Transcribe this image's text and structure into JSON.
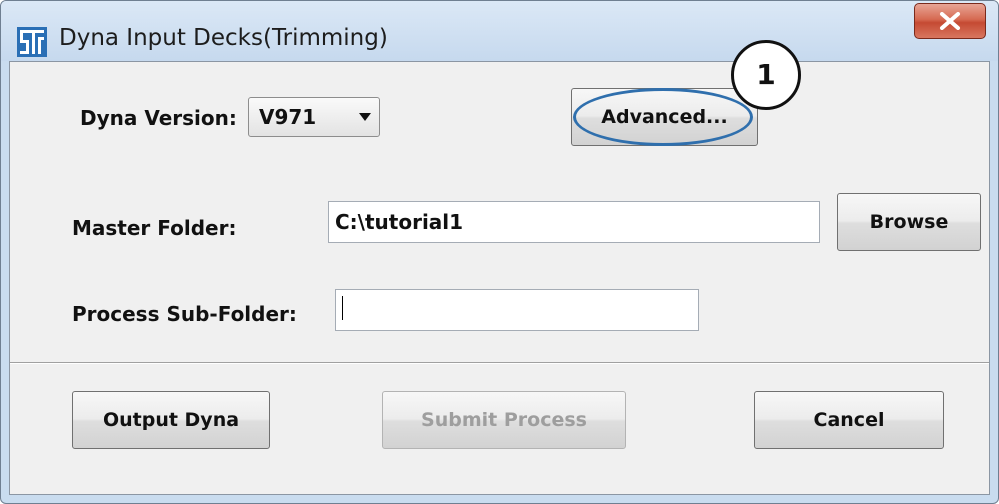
{
  "window": {
    "title": "Dyna Input Decks(Trimming)",
    "close_icon": "close-x-icon",
    "app_icon": "stp-logo-icon"
  },
  "dyna_version": {
    "label": "Dyna Version:",
    "value": "V971"
  },
  "advanced_button": {
    "label": "Advanced..."
  },
  "master_folder": {
    "label": "Master Folder:",
    "value": "C:\\tutorial1",
    "browse_label": "Browse"
  },
  "process_subfolder": {
    "label": "Process Sub-Folder:",
    "value": ""
  },
  "actions": {
    "output_label": "Output Dyna",
    "submit_label": "Submit Process",
    "cancel_label": "Cancel"
  },
  "callout": {
    "number": "1",
    "color": "#2f6fad"
  }
}
